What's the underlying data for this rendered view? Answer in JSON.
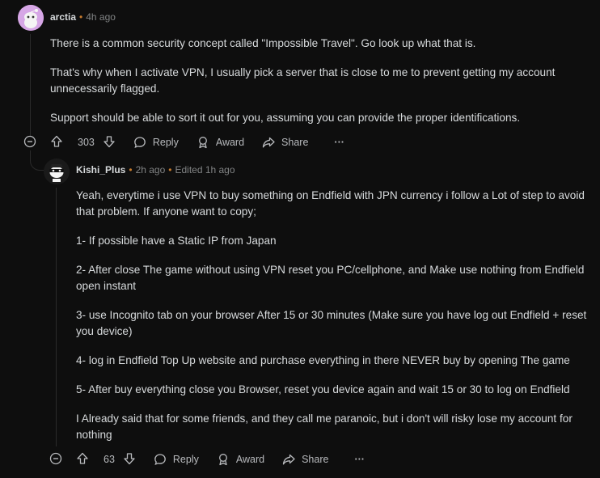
{
  "comments": [
    {
      "author": "arctia",
      "time": "4h ago",
      "edited": "",
      "paragraphs": [
        "There is a common security concept called \"Impossible Travel\". Go look up what that is.",
        "That's why when I activate VPN, I usually pick a server that is close to me to prevent getting my account unnecessarily flagged.",
        "Support should be able to sort it out for you, assuming you can provide the proper identifications."
      ],
      "votes": "303",
      "actions": {
        "reply": "Reply",
        "award": "Award",
        "share": "Share",
        "more": "···"
      }
    },
    {
      "author": "Kishi_Plus",
      "time": "2h ago",
      "edited": "Edited 1h ago",
      "paragraphs": [
        "Yeah, everytime i use VPN to buy something on Endfield with JPN currency i follow a Lot of step to avoid that problem. If anyone want to copy;",
        "1- If possible have a Static IP from Japan",
        "2- After close The game without using VPN reset you PC/cellphone, and Make use nothing from Endfield open instant",
        "3- use Incognito tab on your browser After 15 or 30 minutes (Make sure you have log out Endfield + reset you device)",
        "4- log in Endfield Top Up website and purchase everything in there NEVER buy by opening The game",
        "5- After buy everything close you Browser, reset you device again and wait 15 or 30 to log on Endfield",
        "I Already said that for some friends, and they call me paranoic, but i don't will risky lose my account for nothing"
      ],
      "votes": "63",
      "actions": {
        "reply": "Reply",
        "award": "Award",
        "share": "Share",
        "more": "···"
      }
    }
  ],
  "colors": {
    "background": "#0e0e0e",
    "text": "#d7dadc",
    "meta": "#818384",
    "dot": "#c77b2e"
  },
  "icons": [
    "collapse-icon",
    "upvote-icon",
    "downvote-icon",
    "reply-icon",
    "award-icon",
    "share-icon",
    "more-icon"
  ]
}
